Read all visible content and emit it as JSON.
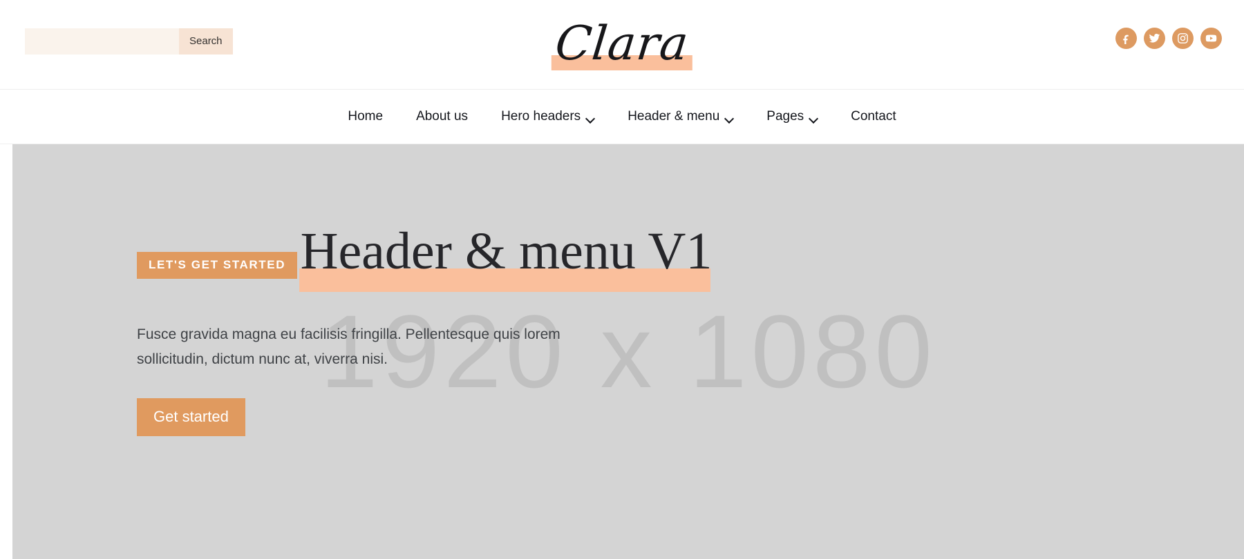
{
  "site": {
    "logo_text": "Clara",
    "accent_color": "#e09a5f",
    "highlight_color": "#fabf9c",
    "social_circle_color": "#dd9a61"
  },
  "topbar": {
    "search": {
      "value": "",
      "placeholder": "",
      "button_label": "Search"
    },
    "socials": [
      {
        "name": "facebook",
        "label": "Facebook"
      },
      {
        "name": "twitter",
        "label": "Twitter"
      },
      {
        "name": "instagram",
        "label": "Instagram"
      },
      {
        "name": "youtube",
        "label": "YouTube"
      }
    ]
  },
  "nav": {
    "items": [
      {
        "label": "Home",
        "has_dropdown": false
      },
      {
        "label": "About us",
        "has_dropdown": false
      },
      {
        "label": "Hero headers",
        "has_dropdown": true
      },
      {
        "label": "Header & menu",
        "has_dropdown": true
      },
      {
        "label": "Pages",
        "has_dropdown": true
      },
      {
        "label": "Contact",
        "has_dropdown": false
      }
    ]
  },
  "hero": {
    "placeholder_text": "1920 x 1080",
    "background_color": "#d4d4d4",
    "badge": "LET'S GET STARTED",
    "title": "Header & menu V1",
    "paragraph": "Fusce gravida magna eu facilisis fringilla. Pellentesque quis lorem sollicitudin, dictum nunc at, viverra nisi.",
    "cta_label": "Get started"
  }
}
